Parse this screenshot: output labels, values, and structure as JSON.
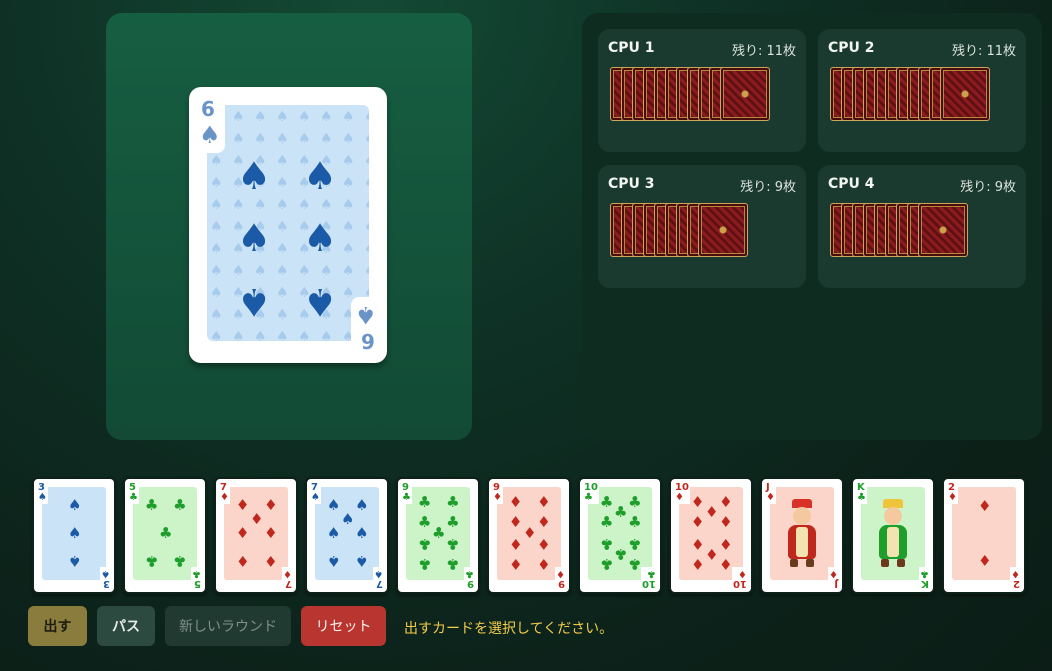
{
  "table": {
    "played_card": {
      "rank": "6",
      "suit": "spade",
      "suit_glyph": "♠",
      "color": "#1a5aa6"
    }
  },
  "cpus": [
    {
      "name": "CPU 1",
      "remaining": "残り: 11枚",
      "cards": 11
    },
    {
      "name": "CPU 2",
      "remaining": "残り: 11枚",
      "cards": 11
    },
    {
      "name": "CPU 3",
      "remaining": "残り: 9枚",
      "cards": 9
    },
    {
      "name": "CPU 4",
      "remaining": "残り: 9枚",
      "cards": 9
    }
  ],
  "hand": [
    {
      "rank": "3",
      "suit": "♠",
      "color": "#1a5aa6",
      "bg": "#cbe3f7"
    },
    {
      "rank": "5",
      "suit": "♣",
      "color": "#1e9e2a",
      "bg": "#cdf3c9"
    },
    {
      "rank": "7",
      "suit": "♦",
      "color": "#c0281e",
      "bg": "#fbd5c9"
    },
    {
      "rank": "7",
      "suit": "♠",
      "color": "#1a5aa6",
      "bg": "#cbe3f7"
    },
    {
      "rank": "9",
      "suit": "♣",
      "color": "#1e9e2a",
      "bg": "#cdf3c9"
    },
    {
      "rank": "9",
      "suit": "♦",
      "color": "#c0281e",
      "bg": "#fbd5c9"
    },
    {
      "rank": "10",
      "suit": "♣",
      "color": "#1e9e2a",
      "bg": "#cdf3c9"
    },
    {
      "rank": "10",
      "suit": "♦",
      "color": "#c0281e",
      "bg": "#fbd5c9"
    },
    {
      "rank": "J",
      "suit": "♦",
      "color": "#c0281e",
      "bg": "#fbd5c9",
      "face": true
    },
    {
      "rank": "K",
      "suit": "♣",
      "color": "#1e9e2a",
      "bg": "#cdf3c9",
      "face": true
    },
    {
      "rank": "2",
      "suit": "♦",
      "color": "#c0281e",
      "bg": "#fbd5c9"
    }
  ],
  "buttons": {
    "play": "出す",
    "pass": "パス",
    "new_round": "新しいラウンド",
    "reset": "リセット"
  },
  "status_message": "出すカードを選択してください。",
  "colors": {
    "play_button": "#8a7c3c",
    "pass_button": "#2d4a40",
    "new_round_button": "#203a31",
    "reset_button": "#b8362f",
    "message": "#f2cc4a"
  }
}
